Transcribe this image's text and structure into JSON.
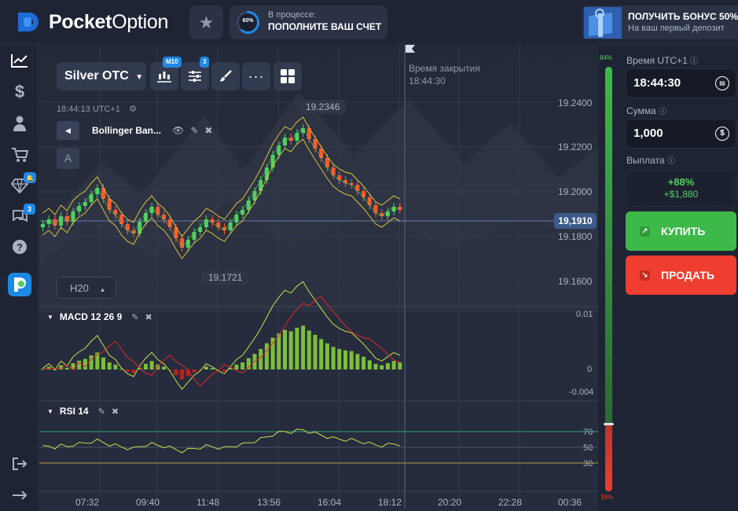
{
  "brand": {
    "name_bold": "Pocket",
    "name_thin": "Option"
  },
  "topbar": {
    "progress_pct": "60%",
    "progress_value": 0.6,
    "progress_title": "В процессе:",
    "progress_sub": "ПОПОЛНИТЕ ВАШ СЧЕТ",
    "bonus_title": "ПОЛУЧИТЬ БОНУС 50%",
    "bonus_sub": "На ваш первый депозит"
  },
  "nav": {
    "badge_alerts": "",
    "badge_chat": "3"
  },
  "chart": {
    "asset": "Silver OTC",
    "m10_badge": "M10",
    "indicators_badge": "3",
    "clock": "18:44:13 UTC+1",
    "indicator_name": "Bollinger Ban...",
    "a_label": "A",
    "timeframe": "H20",
    "high_tag": "19.2346",
    "low_tag": "19.1721",
    "current_price": "19,1910",
    "close_title": "Время закрытия",
    "close_time": "18:44:30",
    "y_ticks": [
      "19.2400",
      "19.2200",
      "19.2000",
      "19.1800",
      "19.1600"
    ],
    "macd_title": "MACD  12 26 9",
    "macd_ticks": [
      "0.01",
      "0",
      "-0.004"
    ],
    "rsi_title": "RSI  14",
    "rsi_ticks": [
      "70",
      "50",
      "30"
    ],
    "x_ticks": [
      "07:32",
      "09:40",
      "11:48",
      "13:56",
      "16:04",
      "18:12",
      "20:20",
      "22:28",
      "00:36"
    ]
  },
  "scale": {
    "top_pct": "84%",
    "bottom_pct": "16%",
    "up_share": 0.84
  },
  "side": {
    "time_label": "Время UTC+1",
    "time_value": "18:44:30",
    "amount_label": "Сумма",
    "amount_value": "1,000",
    "payout_label": "Выплата",
    "payout_pct": "+88%",
    "payout_amount": "+$1,880",
    "buy_label": "КУПИТЬ",
    "sell_label": "ПРОДАТЬ"
  },
  "colors": {
    "up": "#4fd15f",
    "down": "#ff5a2a",
    "buy": "#3db94a",
    "sell": "#ef3d2f",
    "accent": "#1e88e5"
  }
}
